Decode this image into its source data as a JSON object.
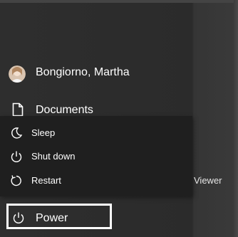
{
  "start_menu": {
    "user": {
      "name": "Bongiorno, Martha",
      "icon": "user-avatar"
    },
    "documents": {
      "label": "Documents",
      "icon": "document-icon"
    },
    "power": {
      "label": "Power",
      "icon": "power-icon"
    }
  },
  "power_flyout": {
    "items": [
      {
        "label": "Sleep",
        "icon": "moon-icon"
      },
      {
        "label": "Shut down",
        "icon": "power-icon"
      },
      {
        "label": "Restart",
        "icon": "restart-icon"
      }
    ]
  },
  "background_app": {
    "label": "Viewer"
  },
  "colors": {
    "menu_bg": "#2b2b2b",
    "flyout_bg": "#1f1f1f",
    "text": "#ffffff",
    "focus_border": "#ffffff"
  }
}
